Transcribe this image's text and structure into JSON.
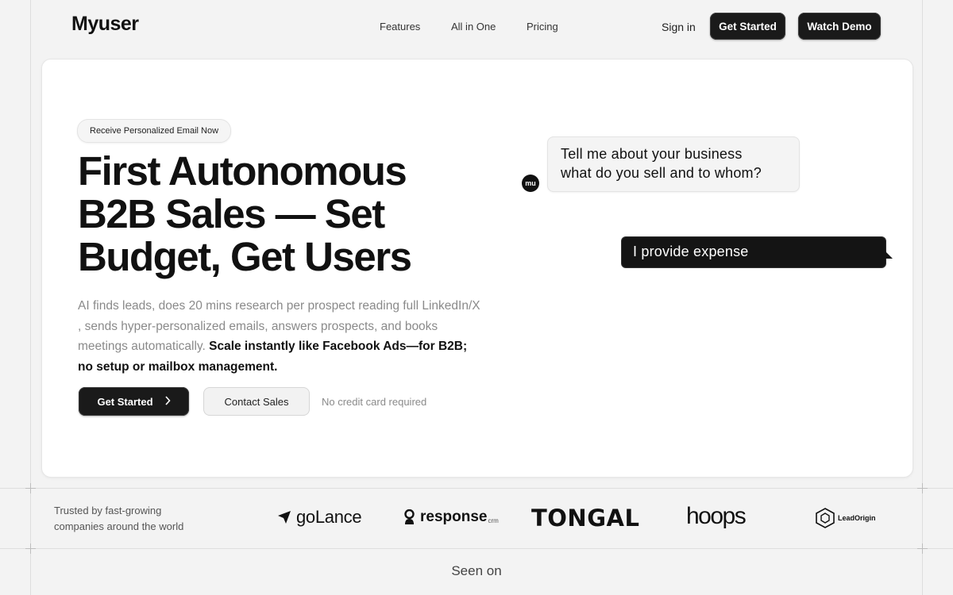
{
  "header": {
    "logo": "Myuser",
    "nav": [
      "Features",
      "All in One",
      "Pricing"
    ],
    "sign_in": "Sign in",
    "get_started": "Get Started",
    "watch_demo": "Watch Demo"
  },
  "hero": {
    "pill": "Receive Personalized Email Now",
    "headline_lines": [
      "First Autonomous",
      "B2B Sales — Set",
      "Budget, Get Users"
    ],
    "description_plain": "AI finds leads, does 20 mins research per prospect reading full LinkedIn/X , sends hyper-personalized emails, answers prospects, and books meetings automatically.",
    "description_bold": "Scale instantly like Facebook Ads—for B2B; no setup or mailbox management.",
    "cta_primary": "Get Started",
    "cta_secondary": "Contact Sales",
    "note": "No credit card required"
  },
  "chat": {
    "avatar": "mu",
    "question_lines": [
      "Tell me about your business",
      "what do you sell and to whom?"
    ],
    "answer": "I provide expense"
  },
  "trusted": {
    "label": "Trusted by fast-growing companies around the world",
    "logos": [
      "goLance",
      "response",
      "crm",
      "TONGAL",
      "hoops",
      "LeadOrigin"
    ]
  },
  "seen_on": "Seen on",
  "icons": [
    "chevron-right-icon",
    "golance-logo-icon",
    "response-logo-icon",
    "leadorigin-hexagon-icon"
  ]
}
